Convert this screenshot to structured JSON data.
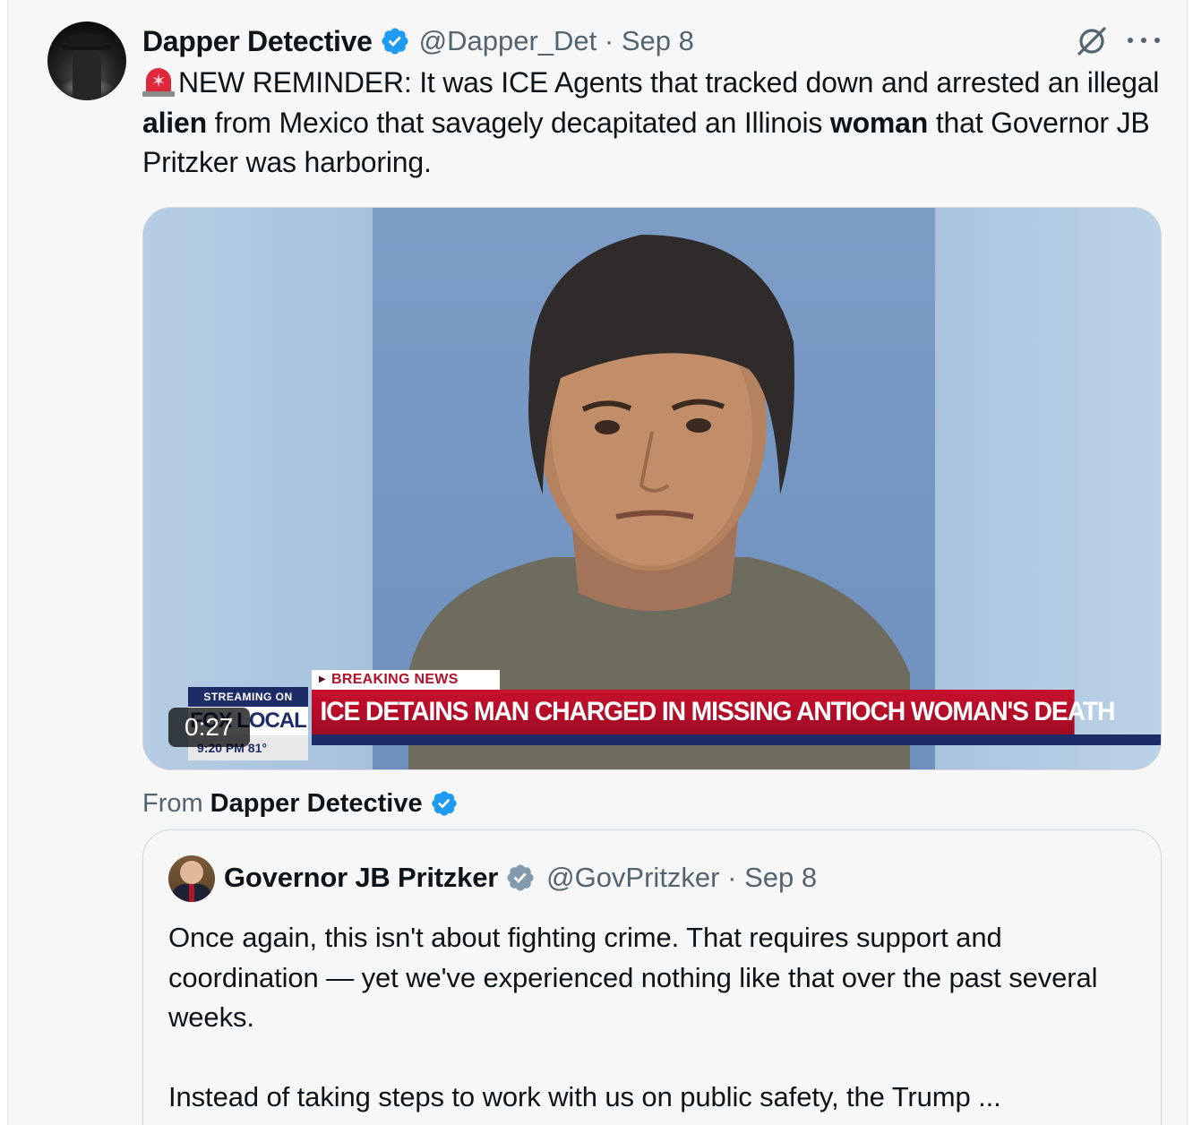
{
  "post": {
    "author": {
      "display_name": "Dapper Detective",
      "handle": "@Dapper_Det",
      "date": "Sep 8",
      "verified": true
    },
    "text": {
      "siren_icon": "police-car-light-emoji",
      "part1": "NEW REMINDER: It was ICE Agents that tracked down and arrested an illegal ",
      "bold1": "alien",
      "part2": " from Mexico that savagely decapitated an Illinois ",
      "bold2": "woman",
      "part3": " that Governor JB Pritzker was harboring."
    },
    "video": {
      "duration": "0:27",
      "breaking_label": "BREAKING NEWS",
      "headline": "ICE DETAINS MAN CHARGED IN MISSING ANTIOCH WOMAN'S DEATH",
      "station_top": "STREAMING ON",
      "station_logo": "FOX LOCAL",
      "station_bottom": "9:20 PM   81°"
    },
    "from": {
      "prefix": "From",
      "name": "Dapper Detective"
    }
  },
  "quoted_post": {
    "author": {
      "display_name": "Governor JB Pritzker",
      "handle": "@GovPritzker",
      "date": "Sep 8",
      "verified_color": "#829aab"
    },
    "text": "Once again, this isn't about fighting crime. That requires support and coordination — yet we've experienced nothing like that over the past several weeks.\n\nInstead of taking steps to work with us on public safety, the Trump ..."
  },
  "colors": {
    "verified_blue": "#1d9bf0",
    "text_primary": "#0f1419",
    "text_secondary": "#536471",
    "breaking_red": "#c8102e",
    "fox_navy": "#1d2c66"
  }
}
